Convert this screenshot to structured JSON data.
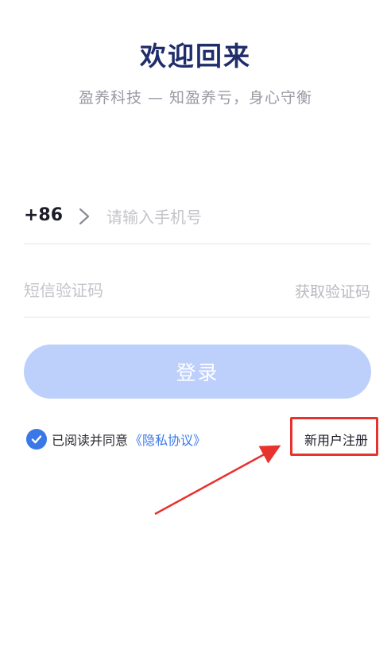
{
  "header": {
    "title": "欢迎回来",
    "subtitle": "盈养科技 — 知盈养亏，身心守衡"
  },
  "phone": {
    "country_code": "+86",
    "placeholder": "请输入手机号",
    "value": ""
  },
  "sms": {
    "placeholder": "短信验证码",
    "value": "",
    "get_code_label": "获取验证码"
  },
  "login": {
    "label": "登录"
  },
  "agreement": {
    "checked": true,
    "prefix": "已阅读并同意",
    "link_label": "《隐私协议》"
  },
  "register": {
    "label": "新用户注册"
  },
  "colors": {
    "title": "#1f2d6b",
    "accent": "#3b78e7",
    "button_disabled": "#bdd0fb",
    "annotation": "#e8322e"
  }
}
